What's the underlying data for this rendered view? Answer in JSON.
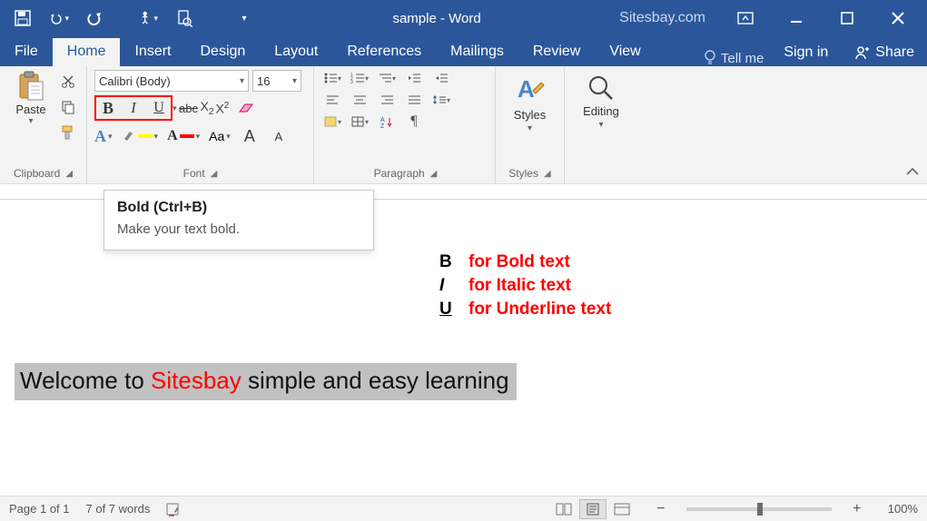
{
  "titlebar": {
    "doc_title": "sample - Word",
    "watermark": "Sitesbay.com"
  },
  "tabs": {
    "file": "File",
    "home": "Home",
    "insert": "Insert",
    "design": "Design",
    "layout": "Layout",
    "references": "References",
    "mailings": "Mailings",
    "review": "Review",
    "view": "View",
    "tell_me": "Tell me",
    "sign_in": "Sign in",
    "share": "Share"
  },
  "ribbon": {
    "clipboard": {
      "title": "Clipboard",
      "paste": "Paste"
    },
    "font": {
      "title": "Font",
      "name": "Calibri (Body)",
      "size": "16",
      "strike": "abc",
      "sub": "X",
      "sup": "X",
      "case": "Aa",
      "grow": "A",
      "shrink": "A"
    },
    "paragraph": {
      "title": "Paragraph"
    },
    "styles": {
      "title": "Styles",
      "label": "Styles"
    },
    "editing": {
      "title": "",
      "label": "Editing"
    }
  },
  "tooltip": {
    "title": "Bold (Ctrl+B)",
    "body": "Make your text bold."
  },
  "legend": {
    "b": "B",
    "b_txt": "for Bold text",
    "i": "I",
    "i_txt": "for Italic text",
    "u": "U",
    "u_txt": "for Underline text"
  },
  "document": {
    "sel_pre": "Welcome to ",
    "sel_hl": "Sitesbay",
    "sel_post": " simple and easy learning"
  },
  "status": {
    "page": "Page 1 of 1",
    "words": "7 of 7 words",
    "zoom": "100%"
  }
}
